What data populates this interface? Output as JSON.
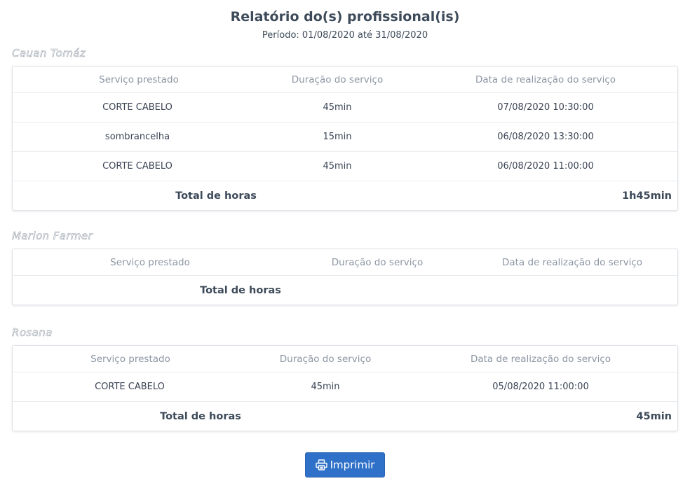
{
  "report": {
    "title": "Relatório do(s) profissional(is)",
    "period": "Período: 01/08/2020 até 31/08/2020"
  },
  "columns": {
    "service": "Serviço prestado",
    "duration": "Duração do serviço",
    "date": "Data de realização do serviço"
  },
  "total_label": "Total de horas",
  "professionals": [
    {
      "name": "Cauan Tomáz",
      "rows": [
        {
          "service": "CORTE CABELO",
          "duration": "45min",
          "date": "07/08/2020 10:30:00"
        },
        {
          "service": "sombrancelha",
          "duration": "15min",
          "date": "06/08/2020 13:30:00"
        },
        {
          "service": "CORTE CABELO",
          "duration": "45min",
          "date": "06/08/2020 11:00:00"
        }
      ],
      "total": "1h45min"
    },
    {
      "name": "Marlon Farmer",
      "rows": [],
      "total": ""
    },
    {
      "name": "Rosana",
      "rows": [
        {
          "service": "CORTE CABELO",
          "duration": "45min",
          "date": "05/08/2020 11:00:00"
        }
      ],
      "total": "45min"
    }
  ],
  "print_button": {
    "label": "Imprimir",
    "icon": "printer-icon",
    "color": "#2f71c8"
  }
}
